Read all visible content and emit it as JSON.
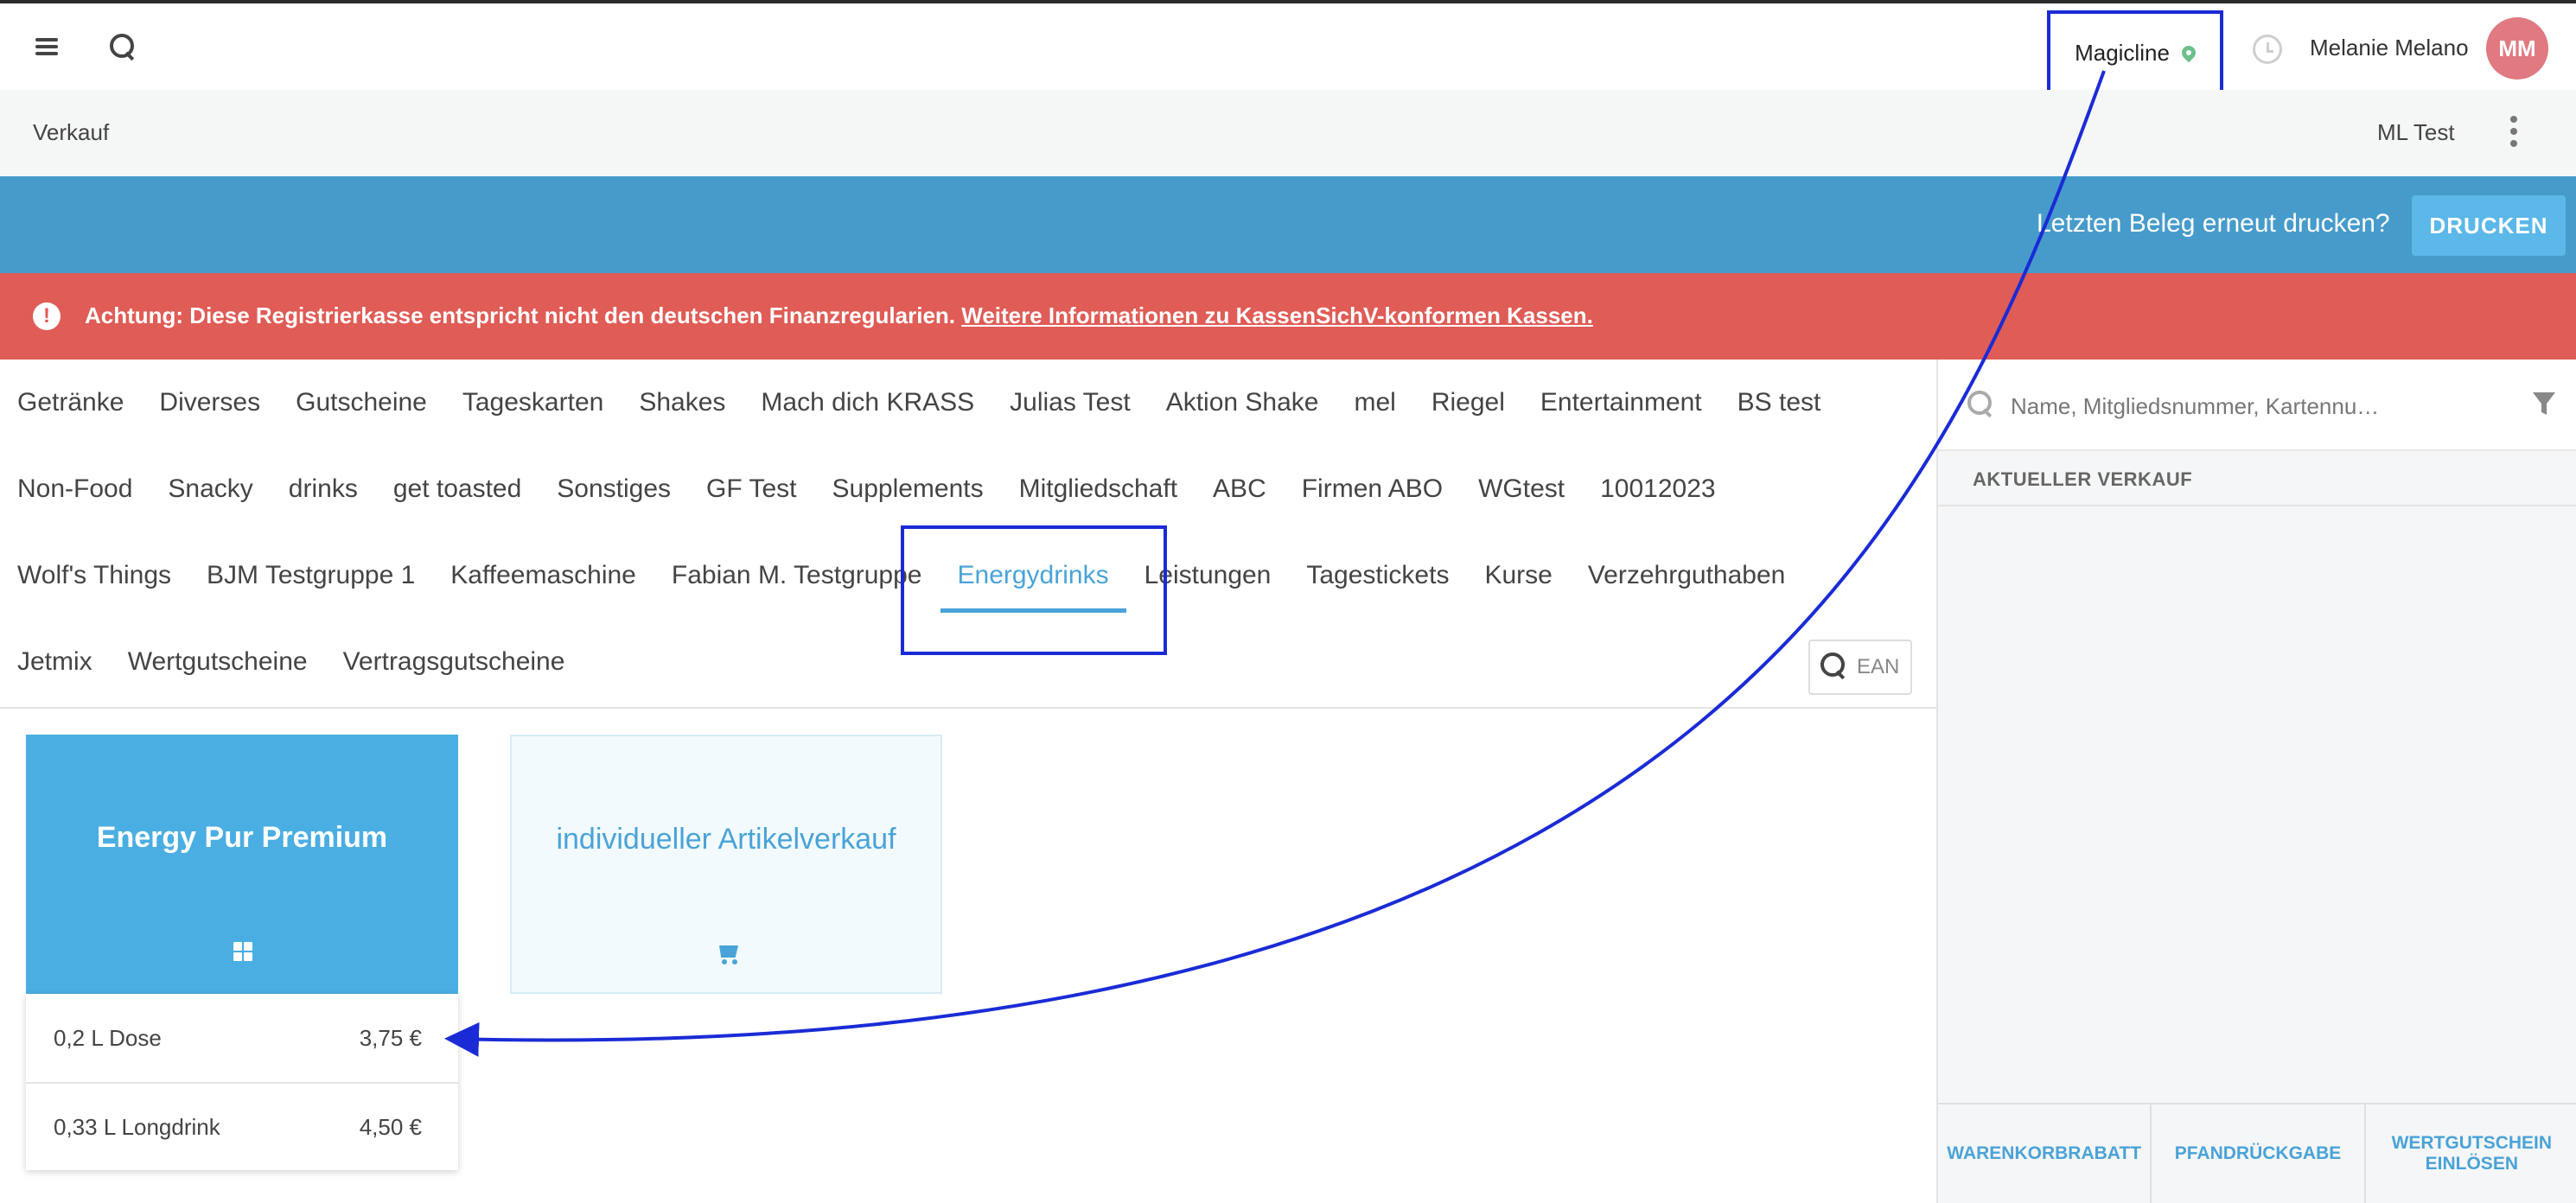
{
  "topbar": {
    "location_label": "Magicline",
    "user_name": "Melanie Melano",
    "avatar_initials": "MM"
  },
  "subheader": {
    "title": "Verkauf",
    "right_label": "ML Test"
  },
  "printbar": {
    "question": "Letzten Beleg erneut drucken?",
    "button_label": "DRUCKEN"
  },
  "warning": {
    "icon_glyph": "!",
    "text": "Achtung: Diese Registrierkasse entspricht nicht den deutschen Finanzregularien.",
    "link": "Weitere Informationen zu KassenSichV-konformen Kassen."
  },
  "categories": {
    "row1": [
      "Getränke",
      "Diverses",
      "Gutscheine",
      "Tageskarten",
      "Shakes",
      "Mach dich KRASS",
      "Julias Test",
      "Aktion Shake",
      "mel",
      "Riegel",
      "Entertainment",
      "BS test"
    ],
    "row2": [
      "Non-Food",
      "Snacky",
      "drinks",
      "get toasted",
      "Sonstiges",
      "GF Test",
      "Supplements",
      "Mitgliedschaft",
      "ABC",
      "Firmen ABO",
      "WGtest",
      "10012023"
    ],
    "row3": [
      "Wolf's Things",
      "BJM Testgruppe 1",
      "Kaffeemaschine",
      "Fabian M. Testgruppe",
      "Energydrinks",
      "Leistungen",
      "Tagestickets",
      "Kurse",
      "Verzehrguthaben"
    ],
    "row4": [
      "Jetmix",
      "Wertgutscheine",
      "Vertragsgutscheine"
    ],
    "active": "Energydrinks"
  },
  "ean": {
    "label": "EAN"
  },
  "products": [
    {
      "title": "Energy Pur Premium",
      "icon": "grid-icon",
      "variants": [
        {
          "name": "0,2 L Dose",
          "price": "3,75 €"
        },
        {
          "name": "0,33 L Longdrink",
          "price": "4,50 €"
        }
      ]
    },
    {
      "title": "individueller Artikelverkauf",
      "icon": "cart-icon"
    }
  ],
  "rightpanel": {
    "search_placeholder": "Name, Mitgliedsnummer, Kartennu…",
    "current_sale_label": "AKTUELLER VERKAUF",
    "actions": [
      "WARENKORBRABATT",
      "PFANDRÜCKGABE",
      "WERTGUTSCHEIN EINLÖSEN"
    ]
  },
  "colors": {
    "accent": "#4aa3d8",
    "printbar": "#469bcb",
    "warning": "#e05c56",
    "annotation": "#1a2bd6"
  }
}
